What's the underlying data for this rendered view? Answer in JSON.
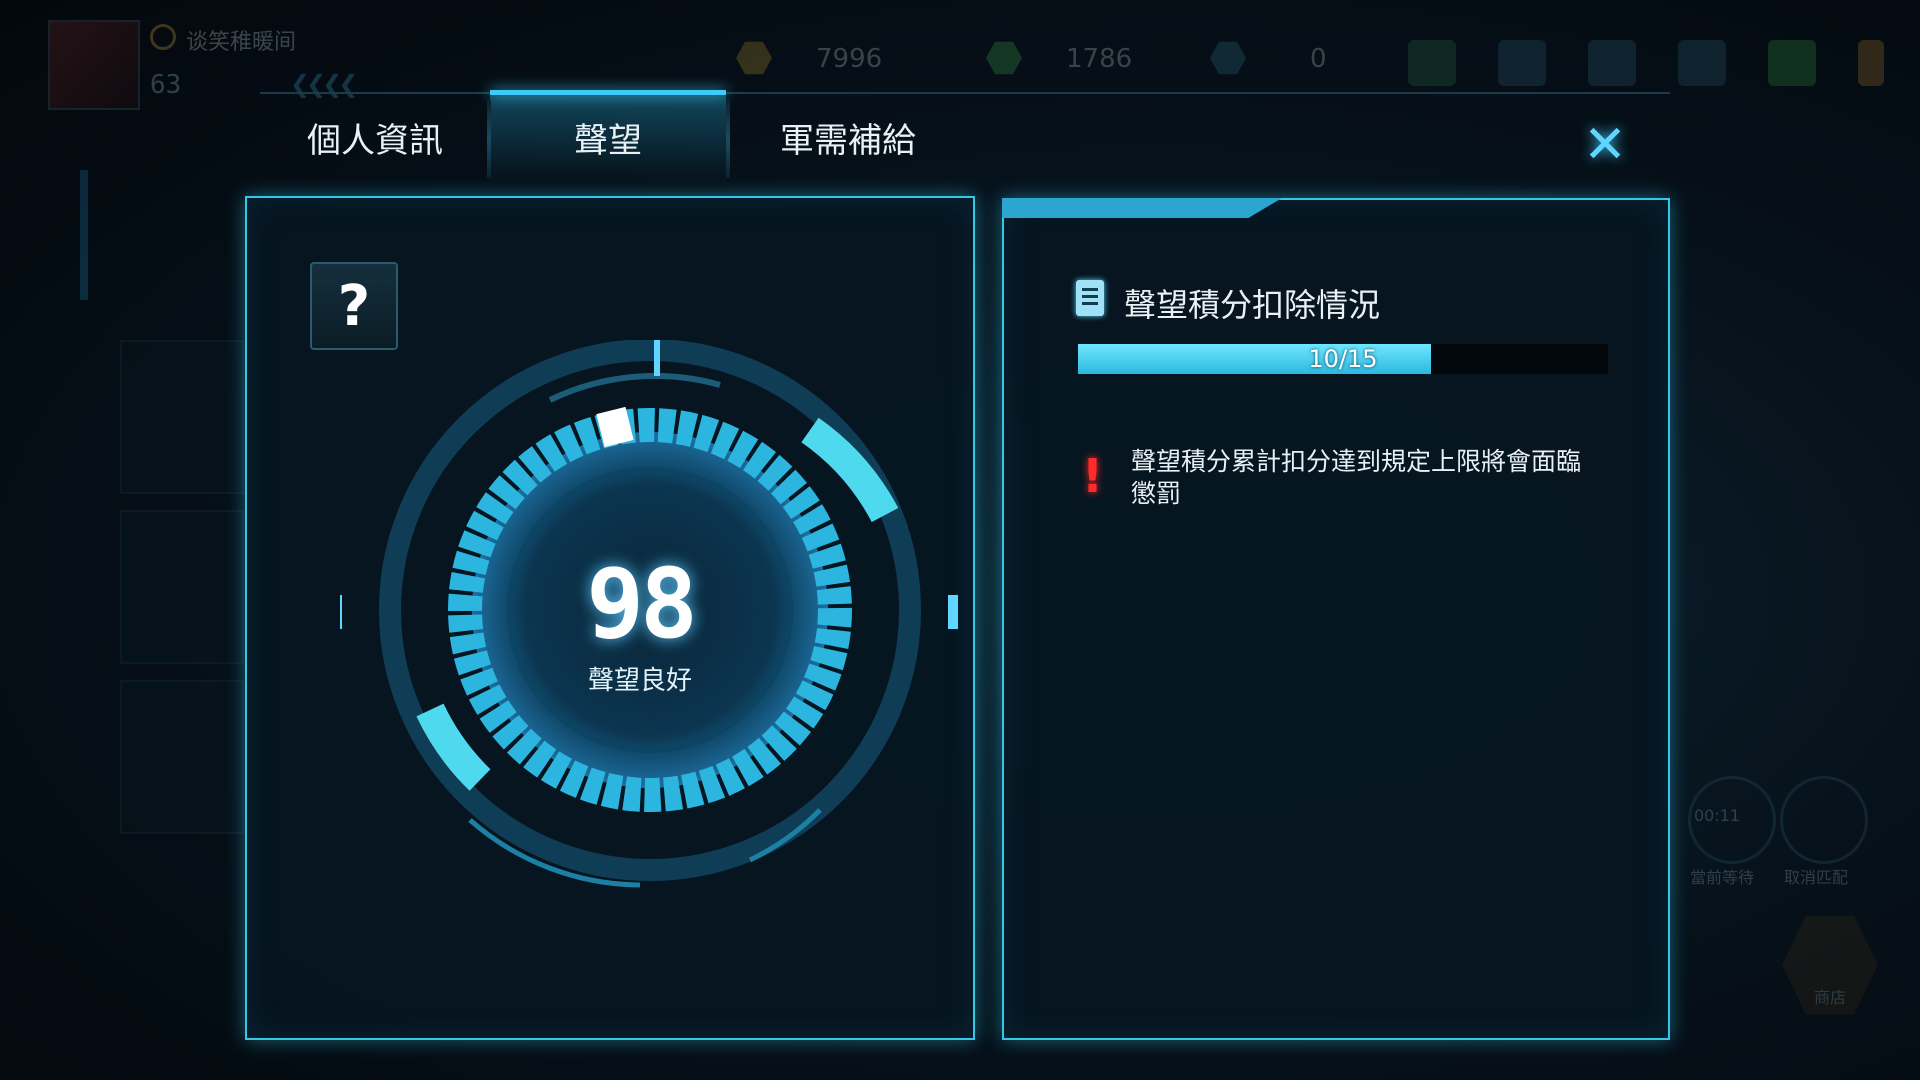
{
  "player": {
    "name": "谈笑稚暖间",
    "level": "63"
  },
  "resources": [
    {
      "name": "gold",
      "value": "7996",
      "color": "#c8a233"
    },
    {
      "name": "crystal",
      "value": "1786",
      "color": "#4fbf59"
    },
    {
      "name": "diamond",
      "value": "0",
      "color": "#3f8fa8"
    }
  ],
  "tabs": [
    {
      "label": "個人資訊",
      "active": false
    },
    {
      "label": "聲望",
      "active": true
    },
    {
      "label": "軍需補給",
      "active": false
    }
  ],
  "close_label": "✕",
  "help_label": "?",
  "reputation": {
    "score": "98",
    "status": "聲望良好"
  },
  "deduction": {
    "title": "聲望積分扣除情況",
    "progress_text": "10/15",
    "progress": 0.6667,
    "warning": "聲望積分累計扣分達到規定上限將會面臨懲罰",
    "warning_icon": "!"
  },
  "background": {
    "timer": "00:11",
    "wait_label": "當前等待",
    "cancel_label": "取消匹配",
    "shop_label": "商店"
  },
  "colors": {
    "accent": "#35c7e8",
    "warning": "#ff2a2a"
  }
}
